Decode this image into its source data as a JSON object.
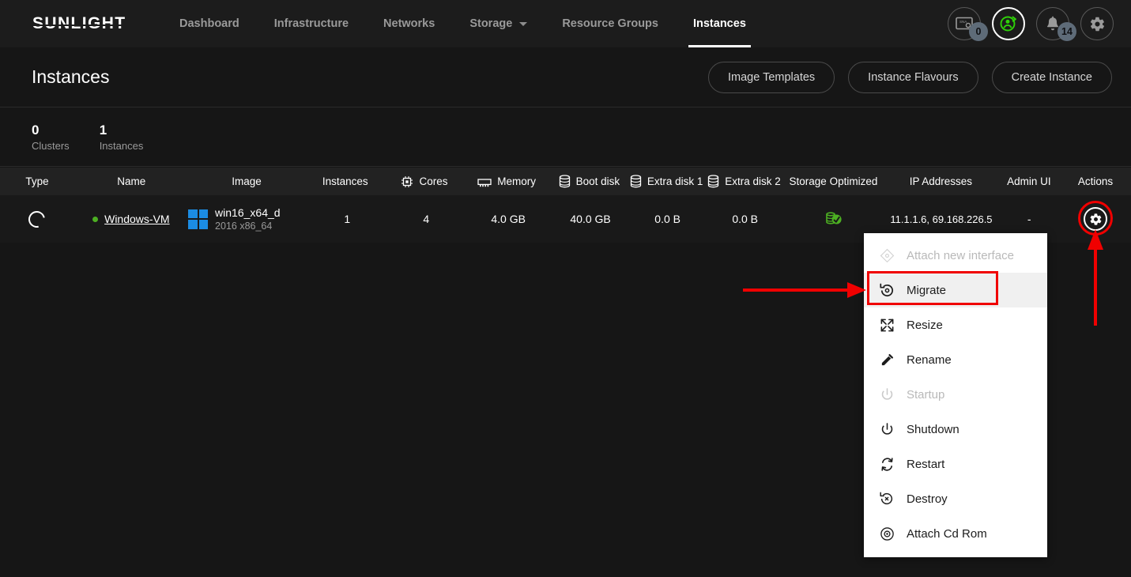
{
  "topnav": {
    "logo": "SUNLIGHT",
    "items": [
      {
        "label": "Dashboard",
        "active": false,
        "caret": false
      },
      {
        "label": "Infrastructure",
        "active": false,
        "caret": false
      },
      {
        "label": "Networks",
        "active": false,
        "caret": false
      },
      {
        "label": "Storage",
        "active": false,
        "caret": true
      },
      {
        "label": "Resource Groups",
        "active": false,
        "caret": false
      },
      {
        "label": "Instances",
        "active": true,
        "caret": false
      }
    ],
    "icons": [
      {
        "name": "console-icon",
        "badge": "0",
        "highlight": false
      },
      {
        "name": "user-sync-icon",
        "badge": "",
        "highlight": true
      },
      {
        "name": "bell-icon",
        "badge": "14",
        "highlight": false
      },
      {
        "name": "gear-icon",
        "badge": "",
        "highlight": false
      }
    ]
  },
  "page": {
    "title": "Instances",
    "buttons": [
      {
        "label": "Image Templates"
      },
      {
        "label": "Instance Flavours"
      },
      {
        "label": "Create Instance"
      }
    ]
  },
  "stats": [
    {
      "value": "0",
      "label": "Clusters"
    },
    {
      "value": "1",
      "label": "Instances"
    }
  ],
  "table": {
    "columns": [
      {
        "label": "Type",
        "icon": ""
      },
      {
        "label": "Name",
        "icon": ""
      },
      {
        "label": "Image",
        "icon": ""
      },
      {
        "label": "Instances",
        "icon": ""
      },
      {
        "label": "Cores",
        "icon": "cpu-icon"
      },
      {
        "label": "Memory",
        "icon": "memory-icon"
      },
      {
        "label": "Boot disk",
        "icon": "disk-icon"
      },
      {
        "label": "Extra disk 1",
        "icon": "disk-icon"
      },
      {
        "label": "Extra disk 2",
        "icon": "disk-icon"
      },
      {
        "label": "Storage Optimized",
        "icon": ""
      },
      {
        "label": "IP Addresses",
        "icon": ""
      },
      {
        "label": "Admin UI",
        "icon": ""
      },
      {
        "label": "Actions",
        "icon": ""
      }
    ],
    "row": {
      "type_icon": "spinner-icon",
      "name": "Windows-VM",
      "status_color": "#4caf22",
      "image_name": "win16_x64_d",
      "image_sub": "2016 x86_64",
      "image_icon": "windows-logo-icon",
      "instances": "1",
      "cores": "4",
      "memory": "4.0 GB",
      "boot_disk": "40.0 GB",
      "extra_disk_1": "0.0 B",
      "extra_disk_2": "0.0 B",
      "storage_optimized_icon": "storage-optimized-icon",
      "ip_addresses": "11.1.1.6, 69.168.226.5",
      "admin_ui": "-",
      "actions_icon": "gear-icon"
    }
  },
  "menu": {
    "items": [
      {
        "label": "Attach new interface",
        "icon": "attach-interface-icon",
        "disabled": true,
        "highlight": false
      },
      {
        "label": "Migrate",
        "icon": "migrate-icon",
        "disabled": false,
        "highlight": true
      },
      {
        "label": "Resize",
        "icon": "resize-icon",
        "disabled": false,
        "highlight": false
      },
      {
        "label": "Rename",
        "icon": "pencil-icon",
        "disabled": false,
        "highlight": false
      },
      {
        "label": "Startup",
        "icon": "power-icon",
        "disabled": true,
        "highlight": false
      },
      {
        "label": "Shutdown",
        "icon": "power-icon",
        "disabled": false,
        "highlight": false
      },
      {
        "label": "Restart",
        "icon": "restart-icon",
        "disabled": false,
        "highlight": false
      },
      {
        "label": "Destroy",
        "icon": "destroy-icon",
        "disabled": false,
        "highlight": false
      },
      {
        "label": "Attach Cd Rom",
        "icon": "cdrom-icon",
        "disabled": false,
        "highlight": false
      }
    ]
  },
  "colors": {
    "accent_green": "#4caf22",
    "annotation_red": "#f00000",
    "windows_blue": "#1b8ce3",
    "badge_bg": "#5e6b78"
  }
}
